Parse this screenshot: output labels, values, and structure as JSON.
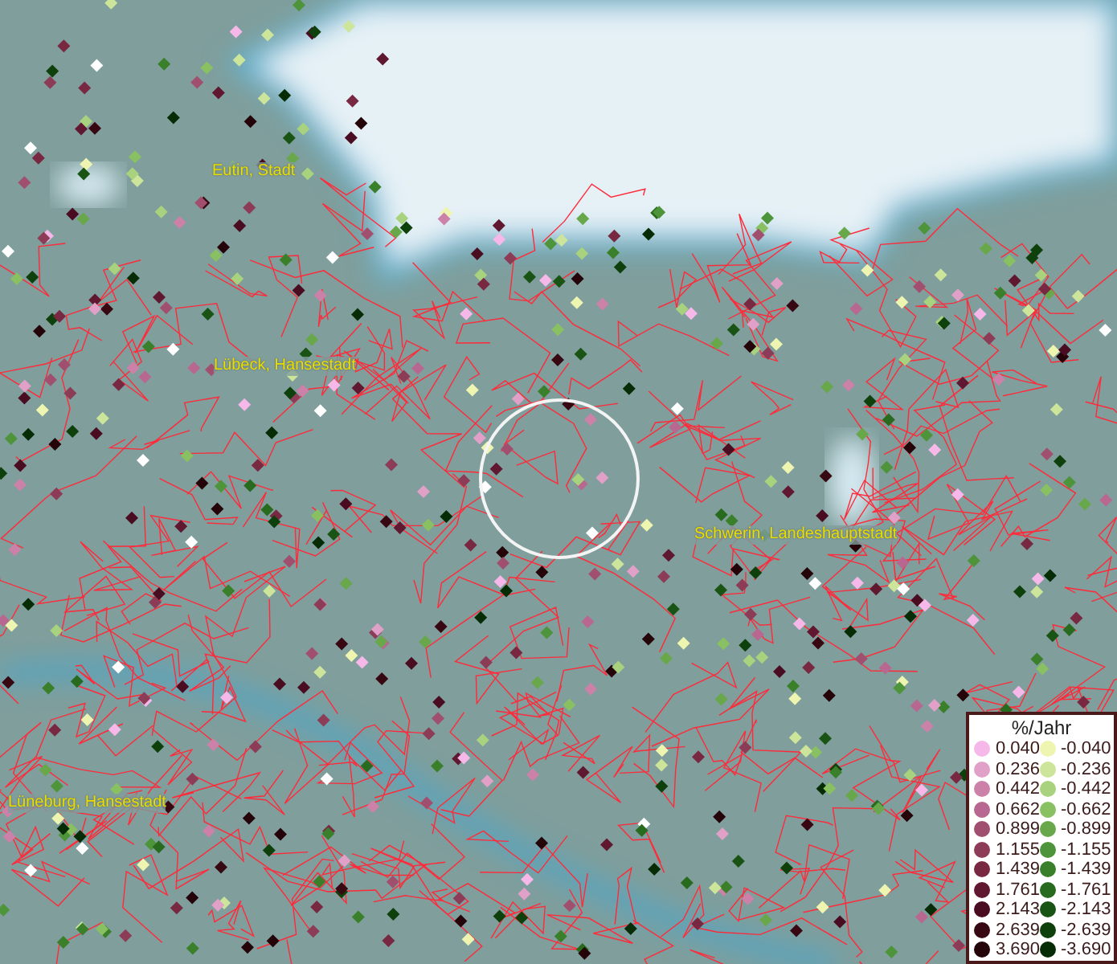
{
  "map": {
    "places": [
      {
        "name": "Eutin, Stadt"
      },
      {
        "name": "Lübeck, Hansestadt"
      },
      {
        "name": "Schwerin, Landeshauptstadt"
      },
      {
        "name": "Lüneburg, Hansestadt"
      }
    ]
  },
  "legend": {
    "title": "%/Jahr",
    "entries": [
      {
        "positive": {
          "label": "0.040",
          "color": "#f5b8e8"
        },
        "negative": {
          "label": "-0.040",
          "color": "#eef5b0"
        }
      },
      {
        "positive": {
          "label": "0.236",
          "color": "#e0a0c8"
        },
        "negative": {
          "label": "-0.236",
          "color": "#cce59a"
        }
      },
      {
        "positive": {
          "label": "0.442",
          "color": "#cc82a8"
        },
        "negative": {
          "label": "-0.442",
          "color": "#a8d27e"
        }
      },
      {
        "positive": {
          "label": "0.662",
          "color": "#b86890"
        },
        "negative": {
          "label": "-0.662",
          "color": "#88c062"
        }
      },
      {
        "positive": {
          "label": "0.899",
          "color": "#a0506e"
        },
        "negative": {
          "label": "-0.899",
          "color": "#68a84a"
        }
      },
      {
        "positive": {
          "label": "1.155",
          "color": "#8c3c56"
        },
        "negative": {
          "label": "-1.155",
          "color": "#4e943a"
        }
      },
      {
        "positive": {
          "label": "1.439",
          "color": "#782840"
        },
        "negative": {
          "label": "-1.439",
          "color": "#3a802a"
        }
      },
      {
        "positive": {
          "label": "1.761",
          "color": "#601830"
        },
        "negative": {
          "label": "-1.761",
          "color": "#286a1e"
        }
      },
      {
        "positive": {
          "label": "2.143",
          "color": "#4a0c20"
        },
        "negative": {
          "label": "-2.143",
          "color": "#1a5414"
        }
      },
      {
        "positive": {
          "label": "2.639",
          "color": "#380812"
        },
        "negative": {
          "label": "-2.639",
          "color": "#0e400c"
        }
      },
      {
        "positive": {
          "label": "3.690",
          "color": "#240408"
        },
        "negative": {
          "label": "-3.690",
          "color": "#062c06"
        }
      }
    ]
  }
}
